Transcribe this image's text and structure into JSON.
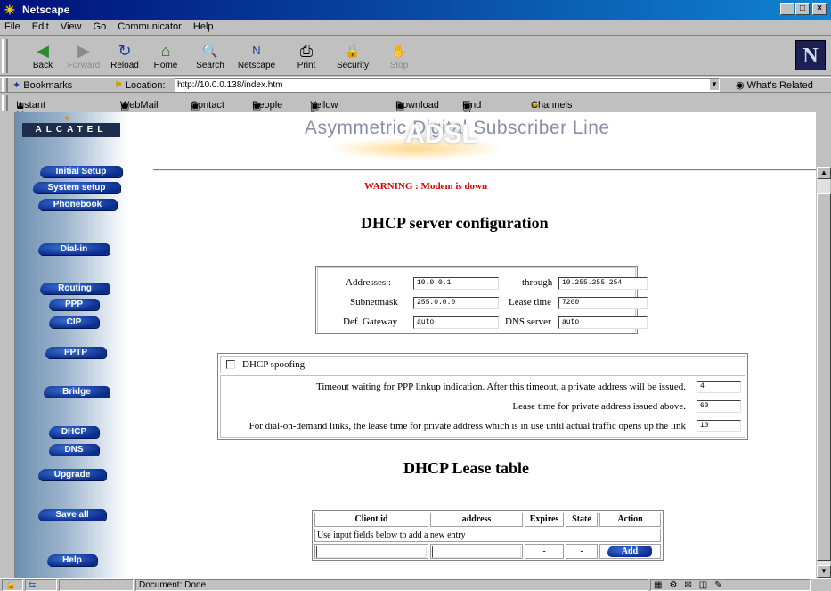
{
  "window": {
    "title": "Netscape",
    "min": "_",
    "max": "□",
    "close": "×"
  },
  "menu": [
    "File",
    "Edit",
    "View",
    "Go",
    "Communicator",
    "Help"
  ],
  "toolbar": [
    {
      "label": "Back",
      "icon": "◀",
      "enabled": true
    },
    {
      "label": "Forward",
      "icon": "▶",
      "enabled": false
    },
    {
      "label": "Reload",
      "icon": "↻",
      "enabled": true
    },
    {
      "label": "Home",
      "icon": "⌂",
      "enabled": true
    },
    {
      "label": "Search",
      "icon": "🔍",
      "enabled": true
    },
    {
      "label": "Netscape",
      "icon": "N",
      "enabled": true
    },
    {
      "label": "Print",
      "icon": "⎙",
      "enabled": true
    },
    {
      "label": "Security",
      "icon": "🔒",
      "enabled": true
    },
    {
      "label": "Stop",
      "icon": "✋",
      "enabled": false
    }
  ],
  "logo": "N",
  "location": {
    "bookmarks": "Bookmarks",
    "label": "Location:",
    "url": "http://10.0.0.138/index.htm",
    "related": "What's Related"
  },
  "personal": [
    "Instant Message",
    "WebMail",
    "Contact",
    "People",
    "Yellow Pages",
    "Download",
    "Find Sites",
    "Channels"
  ],
  "sidebar": {
    "brand": "ALCATEL",
    "items": [
      "Initial Setup",
      "System setup",
      "Phonebook",
      "Dial-in",
      "Routing",
      "PPP",
      "CIP",
      "PPTP",
      "Bridge",
      "DHCP",
      "DNS",
      "Upgrade",
      "Save all",
      "Help"
    ]
  },
  "banner": {
    "line1": "Asymmetric Digital Subscriber Line",
    "adsl": "ADSL"
  },
  "warning": "WARNING : Modem is down",
  "dhcp": {
    "title": "DHCP server configuration",
    "addresses_label": "Addresses :",
    "addresses_from": "10.0.0.1",
    "through_label": "through",
    "addresses_to": "10.255.255.254",
    "subnet_label": "Subnetmask",
    "subnet": "255.0.0.0",
    "lease_label": "Lease time",
    "lease": "7200",
    "gateway_label": "Def. Gateway",
    "gateway": "auto",
    "dns_label": "DNS server",
    "dns": "auto"
  },
  "spoofing": {
    "label": "DHCP spoofing",
    "timeout_label": "Timeout waiting for PPP linkup indication. After this timeout, a private address will be issued.",
    "timeout": "4",
    "leasetime_label": "Lease time for private address issued above.",
    "leasetime": "60",
    "dialdemand_label": "For dial-on-demand links, the lease time for private address which is in use until actual traffic opens up the link",
    "dialdemand": "10"
  },
  "lease_table": {
    "title": "DHCP Lease table",
    "headers": [
      "Client id",
      "address",
      "Expires",
      "State",
      "Action"
    ],
    "note": "Use input fields below to add a new entry",
    "expires": "-",
    "state": "-",
    "add": "Add"
  },
  "status": {
    "text": "Document: Done"
  }
}
